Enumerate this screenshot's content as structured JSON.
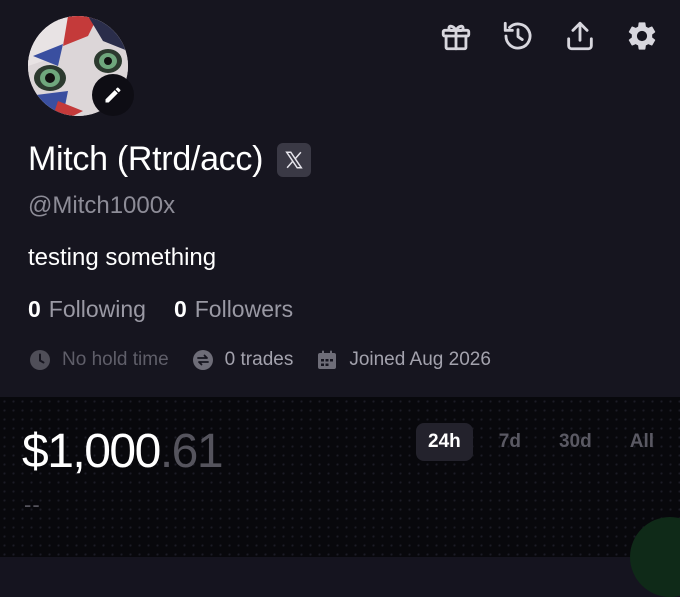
{
  "profile": {
    "display_name": "Mitch (Rtrd/acc)",
    "handle": "@Mitch1000x",
    "bio": "testing something",
    "following_count": "0",
    "following_label": "Following",
    "followers_count": "0",
    "followers_label": "Followers",
    "meta": {
      "hold_time": "No hold time",
      "trades": "0 trades",
      "joined": "Joined Aug 2026"
    }
  },
  "header_icons": [
    "gift-icon",
    "history-icon",
    "share-icon",
    "settings-icon"
  ],
  "portfolio": {
    "balance_main": "$1,000",
    "balance_cents": ".61",
    "change": "--",
    "ranges": [
      {
        "label": "24h",
        "active": true
      },
      {
        "label": "7d",
        "active": false
      },
      {
        "label": "30d",
        "active": false
      },
      {
        "label": "All",
        "active": false
      }
    ]
  },
  "colors": {
    "background": "#16151f",
    "portfolio_bg": "#08080c",
    "muted_text": "#8d8c97",
    "active_range_bg": "#23222c"
  }
}
